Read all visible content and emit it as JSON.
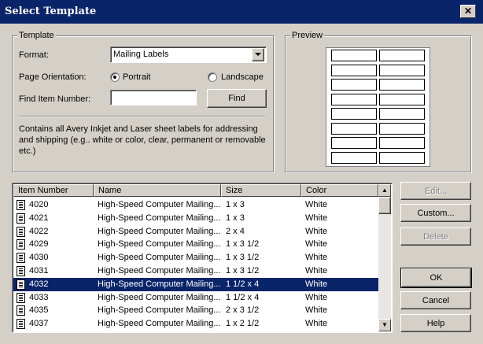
{
  "window": {
    "title": "Select Template",
    "close_glyph": "✕"
  },
  "template_group": {
    "label": "Template",
    "format_label": "Format:",
    "format_value": "Mailing Labels",
    "orientation_label": "Page Orientation:",
    "portrait_label": "Portrait",
    "landscape_label": "Landscape",
    "orientation_selected": "Portrait",
    "find_label": "Find Item Number:",
    "find_value": "",
    "find_button": "Find",
    "description": "Contains all Avery Inkjet and Laser sheet labels for addressing and shipping (e.g.. white or color, clear, permanent or removable etc.)"
  },
  "preview": {
    "label": "Preview",
    "label_rows": 8,
    "label_cols": 2
  },
  "list": {
    "columns": [
      "Item Number",
      "Name",
      "Size",
      "Color"
    ],
    "rows": [
      {
        "item": "4020",
        "name": "High-Speed Computer Mailing...",
        "size": "1 x 3",
        "color": "White",
        "selected": false
      },
      {
        "item": "4021",
        "name": "High-Speed Computer Mailing...",
        "size": "1 x 3",
        "color": "White",
        "selected": false
      },
      {
        "item": "4022",
        "name": "High-Speed Computer Mailing...",
        "size": "2 x 4",
        "color": "White",
        "selected": false
      },
      {
        "item": "4029",
        "name": "High-Speed Computer Mailing...",
        "size": "1 x 3 1/2",
        "color": "White",
        "selected": false
      },
      {
        "item": "4030",
        "name": "High-Speed Computer Mailing...",
        "size": "1 x 3 1/2",
        "color": "White",
        "selected": false
      },
      {
        "item": "4031",
        "name": "High-Speed Computer Mailing...",
        "size": "1 x 3 1/2",
        "color": "White",
        "selected": false
      },
      {
        "item": "4032",
        "name": "High-Speed Computer Mailing...",
        "size": "1 1/2 x 4",
        "color": "White",
        "selected": true
      },
      {
        "item": "4033",
        "name": "High-Speed Computer Mailing...",
        "size": "1 1/2 x 4",
        "color": "White",
        "selected": false
      },
      {
        "item": "4035",
        "name": "High-Speed Computer Mailing...",
        "size": "2 x 3 1/2",
        "color": "White",
        "selected": false
      },
      {
        "item": "4037",
        "name": "High-Speed Computer Mailing...",
        "size": "1 x 2 1/2",
        "color": "White",
        "selected": false
      }
    ]
  },
  "buttons": {
    "edit": "Edit...",
    "custom": "Custom...",
    "delete": "Delete",
    "ok": "OK",
    "cancel": "Cancel",
    "help": "Help"
  },
  "colors": {
    "title_bar": "#0a246a",
    "selection": "#0a246a",
    "face": "#d4d0c8"
  }
}
